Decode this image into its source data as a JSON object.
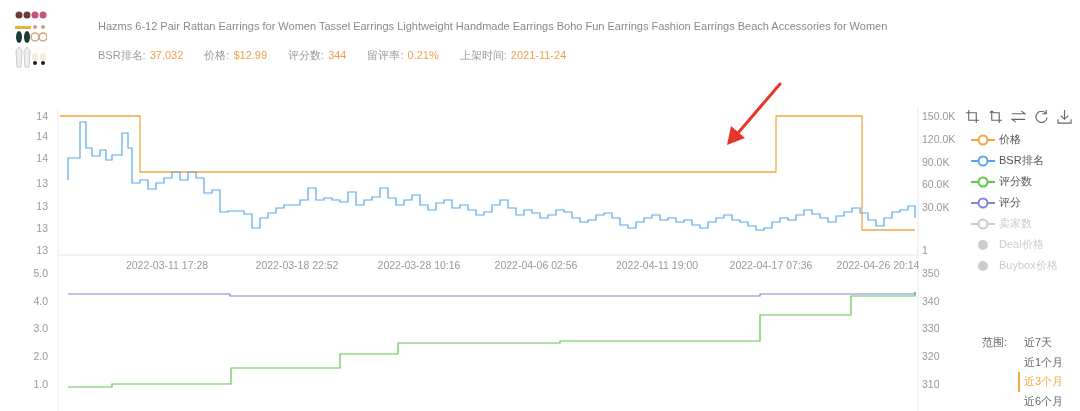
{
  "product": {
    "title": "Hazms 6-12 Pair Rattan Earrings for Women Tassel Earrings Lightweight Handmade Earrings Boho Fun Earrings Fashion Earrings Beach Accessories for Women",
    "stats": [
      {
        "label": "BSR排名:",
        "value": "37,032"
      },
      {
        "label": "价格:",
        "value": "$12.99"
      },
      {
        "label": "评分数:",
        "value": "344"
      },
      {
        "label": "留评率:",
        "value": "0.21%"
      },
      {
        "label": "上架时间:",
        "value": "2021-11-24"
      }
    ]
  },
  "top_chart": {
    "left_ticks": [
      "14",
      "14",
      "14",
      "13",
      "13",
      "13",
      "13"
    ],
    "right_ticks": [
      "150.0K",
      "120.0K",
      "90.0K",
      "60.0K",
      "30.0K",
      "1"
    ],
    "x_labels": [
      "2022-03-11 17:28",
      "2022-03-18 22:52",
      "2022-03-28 10:16",
      "2022-04-06 02:56",
      "2022-04-11 19:00",
      "2022-04-17 07:36",
      "2022-04-26 20:14"
    ]
  },
  "bottom_chart": {
    "left_ticks": [
      "5.0",
      "4.0",
      "3.0",
      "2.0",
      "1.0"
    ],
    "right_ticks": [
      "350",
      "340",
      "330",
      "320",
      "310"
    ]
  },
  "legend": [
    {
      "label": "价格",
      "kind": "line",
      "color": "#f5a742",
      "enabled": true
    },
    {
      "label": "BSR排名",
      "kind": "line",
      "color": "#5aa7e8",
      "enabled": true
    },
    {
      "label": "评分数",
      "kind": "line",
      "color": "#5cc84a",
      "enabled": true
    },
    {
      "label": "评分",
      "kind": "line",
      "color": "#7f86dc",
      "enabled": true
    },
    {
      "label": "卖家数",
      "kind": "line",
      "enabled": false
    },
    {
      "label": "Deal价格",
      "kind": "dot",
      "enabled": false
    },
    {
      "label": "Buybox价格",
      "kind": "dot",
      "enabled": false
    }
  ],
  "range": {
    "label": "范围:",
    "options": [
      {
        "label": "近7天",
        "selected": false
      },
      {
        "label": "近1个月",
        "selected": false
      },
      {
        "label": "近3个月",
        "selected": true
      },
      {
        "label": "近6个月",
        "selected": false
      }
    ]
  }
}
